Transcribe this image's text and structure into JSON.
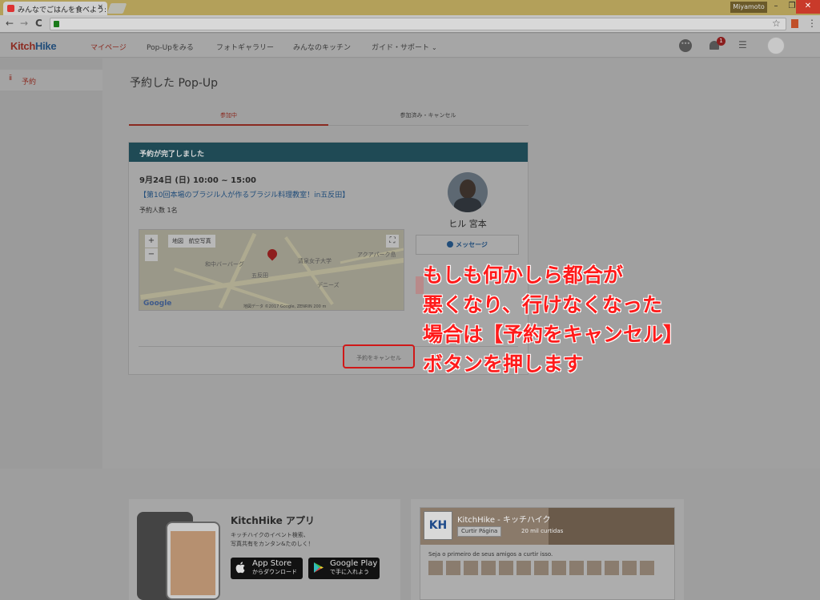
{
  "browser": {
    "tab_title": "みんなでごはんを食べよう:",
    "tab_close": "×",
    "user_badge": "Miyamoto",
    "win_min": "–",
    "win_max": "❐",
    "win_close": "✕",
    "back": "←",
    "forward": "→",
    "reload": "C",
    "star": "☆",
    "menu": "⋮"
  },
  "header": {
    "logo_kitch": "Kitch",
    "logo_hike": "Hike",
    "nav": {
      "mypage": "マイページ",
      "popup": "Pop-Upをみる",
      "gallery": "フォトギャラリー",
      "kitchen": "みんなのキッチン",
      "guide": "ガイド・サポート"
    },
    "chevron": "⌄",
    "notification_count": "1",
    "list_icon": "☰"
  },
  "sidebar": {
    "icon": "ⅱ",
    "label": "予約"
  },
  "main": {
    "title": "予約した Pop-Up",
    "tabs": {
      "active": "参加中",
      "inactive": "参加済み・キャンセル"
    }
  },
  "card": {
    "header": "予約が完了しました",
    "date": "9月24日 (日) 10:00 ~ 15:00",
    "event": "【第10回本場のブラジル人が作るブラジル料理教室！in五反田】",
    "count": "予約人数 1名",
    "host_name": "ヒル 宮本",
    "message_button": "メッセージ",
    "cancel_button": "予約をキャンセル"
  },
  "map": {
    "zoom_in": "+",
    "zoom_out": "−",
    "map_label": "地図",
    "satellite_label": "航空写真",
    "fullscreen": "⛶",
    "logo": "Google",
    "copyright": "地図データ ©2017 Google, ZENRIN  200 m",
    "places": {
      "tokyo": "和中バーバーグ",
      "school": "清泉女子大学",
      "akua": "アクアパーク島",
      "denny": "デニーズ",
      "gotanda": "五反田"
    }
  },
  "annotation": {
    "line1": "もしも何かしら都合が",
    "line2": "悪くなり、行けなくなった",
    "line3": "場合は【予約をキャンセル】",
    "line4": "ボタンを押します"
  },
  "footer": {
    "app_title": "KitchHike アプリ",
    "app_desc1": "キッチハイクのイベント検索、",
    "app_desc2": "写真共有をカンタン&たのしく！",
    "appstore_big": "App Store",
    "appstore_small": "からダウンロード",
    "googleplay_big": "Google Play",
    "googleplay_small": "で手に入れよう",
    "fb_logo": "KH",
    "fb_page_name": "KitchHike - キッチハイク",
    "fb_like": "Curtir Página",
    "fb_count": "20 mil curtidas",
    "fb_friends": "Seja o primeiro de seus amigos a curtir isso."
  },
  "colors": {
    "accent": "#8a2a20",
    "card_header": "#1f4a55",
    "annotation": "#ff1b1b"
  }
}
